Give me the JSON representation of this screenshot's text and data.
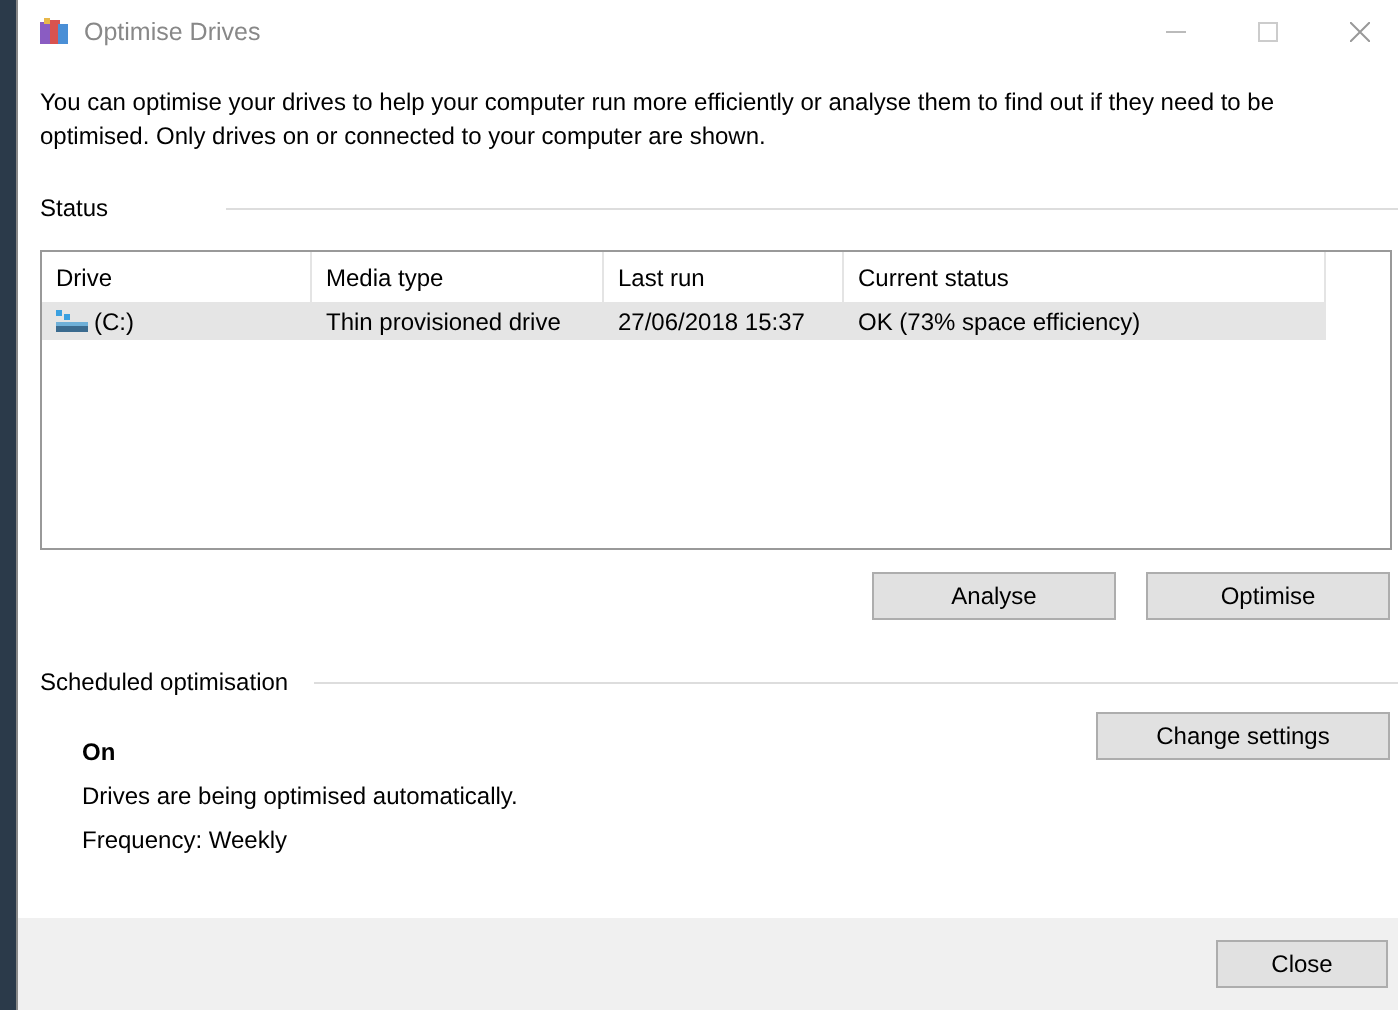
{
  "window": {
    "title": "Optimise Drives"
  },
  "description": "You can optimise your drives to help your computer run more efficiently or analyse them to find out if they need to be optimised. Only drives on or connected to your computer are shown.",
  "status": {
    "heading": "Status",
    "table": {
      "columns": [
        "Drive",
        "Media type",
        "Last run",
        "Current status"
      ],
      "rows": [
        {
          "drive": "(C:)",
          "media_type": "Thin provisioned drive",
          "last_run": "27/06/2018 15:37",
          "current_status": "OK (73% space efficiency)",
          "selected": true
        }
      ]
    },
    "buttons": [
      "Analyse",
      "Optimise"
    ]
  },
  "schedule": {
    "heading": "Scheduled optimisation",
    "state": "On",
    "detail": "Drives are being optimised automatically.",
    "frequency": "Frequency: Weekly",
    "button": "Change settings"
  },
  "footer": {
    "button": "Close"
  }
}
